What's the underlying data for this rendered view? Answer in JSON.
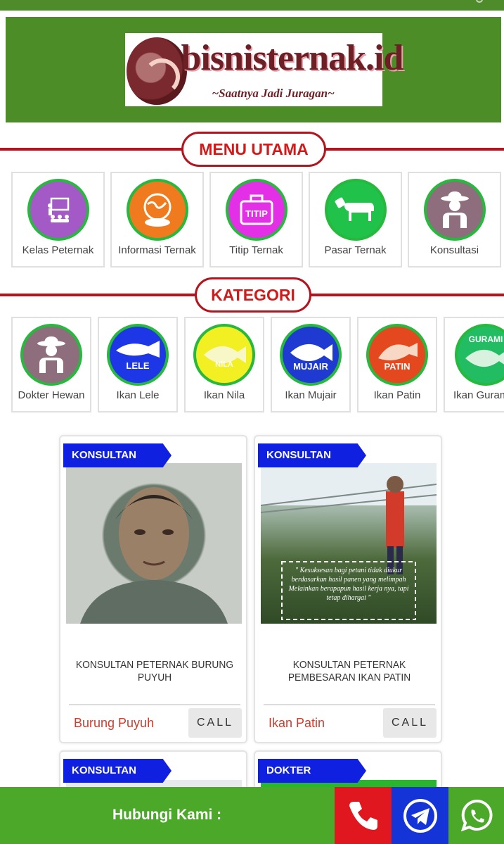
{
  "header": {
    "logo_text": "bisnisternak.id",
    "logo_tagline": "~Saatnya Jadi Juragan~"
  },
  "sections": {
    "menu_title": "MENU UTAMA",
    "category_title": "KATEGORI"
  },
  "menu": [
    {
      "label": "Kelas Peternak",
      "icon": "class-presentation-icon",
      "color": "#a35ac6"
    },
    {
      "label": "Informasi Ternak",
      "icon": "globe-livestock-icon",
      "color": "#f07a1e"
    },
    {
      "label": "Titip Ternak",
      "icon": "luggage-titip-icon",
      "color": "#e330e6"
    },
    {
      "label": "Pasar Ternak",
      "icon": "cow-tag-icon",
      "color": "#21c24a"
    },
    {
      "label": "Konsultasi",
      "icon": "farmer-icon",
      "color": "#8e6e7c"
    }
  ],
  "categories": [
    {
      "label": "Dokter Hewan",
      "icon": "farmer-icon",
      "badge": "",
      "color": "#8e6e7c"
    },
    {
      "label": "Ikan Lele",
      "icon": "catfish-icon",
      "badge": "LELE",
      "color": "#1d36e6"
    },
    {
      "label": "Ikan Nila",
      "icon": "tilapia-icon",
      "badge": "NILA",
      "color": "#f2ef22"
    },
    {
      "label": "Ikan Mujair",
      "icon": "mujair-fish-icon",
      "badge": "MUJAIR",
      "color": "#1f3ad0"
    },
    {
      "label": "Ikan Patin",
      "icon": "patin-fish-icon",
      "badge": "PATIN",
      "color": "#e4481e"
    },
    {
      "label": "Ikan Gurami",
      "icon": "gurami-fish-icon",
      "badge": "GURAMI",
      "color": "#22bd63"
    }
  ],
  "listings": [
    {
      "badge": "KONSULTAN",
      "title": "KONSULTAN PETERNAK BURUNG PUYUH",
      "tag": "Burung Puyuh",
      "call_label": "CALL"
    },
    {
      "badge": "KONSULTAN",
      "title": "KONSULTAN PETERNAK PEMBESARAN IKAN PATIN",
      "tag": "Ikan Patin",
      "call_label": "CALL",
      "photo_quote": "\" Kesuksesan bagi petani tidak diukur berdasarkan hasil panen yang melimpah Melainkan berapapun hasil kerja nya, tapi tetap dihargai \""
    },
    {
      "badge": "KONSULTAN"
    },
    {
      "badge": "DOKTER"
    }
  ],
  "footer": {
    "contact_label": "Hubungi Kami :",
    "buttons": [
      {
        "icon": "phone-icon",
        "color": "#e0171f"
      },
      {
        "icon": "telegram-icon",
        "color": "#1434d8"
      },
      {
        "icon": "whatsapp-icon",
        "color": "#4ba828"
      }
    ]
  },
  "colors": {
    "brand_green": "#4d8d28",
    "accent_red": "#b3141d",
    "ribbon_blue": "#1020e0"
  }
}
